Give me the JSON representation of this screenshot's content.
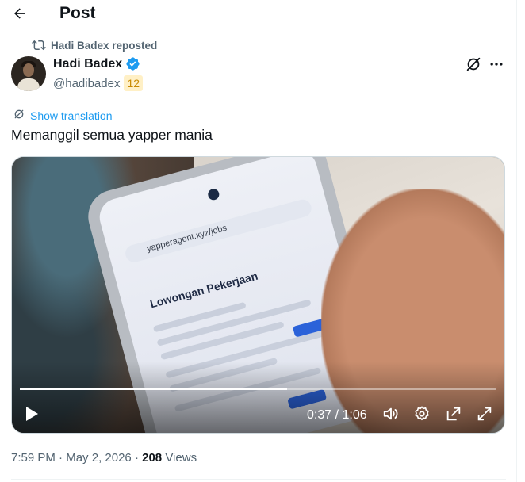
{
  "header": {
    "title": "Post"
  },
  "repost": {
    "text": "Hadi Badex reposted"
  },
  "author": {
    "name": "Hadi Badex",
    "handle": "@hadibadex",
    "badge": "12"
  },
  "post": {
    "translate_label": "Show translation",
    "text": "Memanggil semua yapper mania"
  },
  "video": {
    "screen_url": "yapperagent.xyz/jobs",
    "screen_title": "Lowongan Pekerjaan",
    "current_time": "0:37",
    "duration": "1:06",
    "time_display": "0:37 / 1:06",
    "progress_fraction": 0.5606
  },
  "meta": {
    "time": "7:59 PM",
    "separator": " · ",
    "date": "May 2, 2026",
    "views_count": "208",
    "views_label": "Views"
  },
  "icons": {
    "back": "arrow-left-icon",
    "repost": "repost-icon",
    "verified": "verified-badge-icon",
    "grok": "grok-icon",
    "more": "more-icon",
    "translate": "translate-icon",
    "play": "play-icon",
    "volume": "volume-icon",
    "settings": "settings-icon",
    "pip": "picture-in-picture-icon",
    "fullscreen": "fullscreen-icon"
  },
  "colors": {
    "text": "#0f1419",
    "secondary": "#536471",
    "accent": "#1d9bf0",
    "badge_bg": "#fff0c6",
    "badge_fg": "#c98a00"
  }
}
